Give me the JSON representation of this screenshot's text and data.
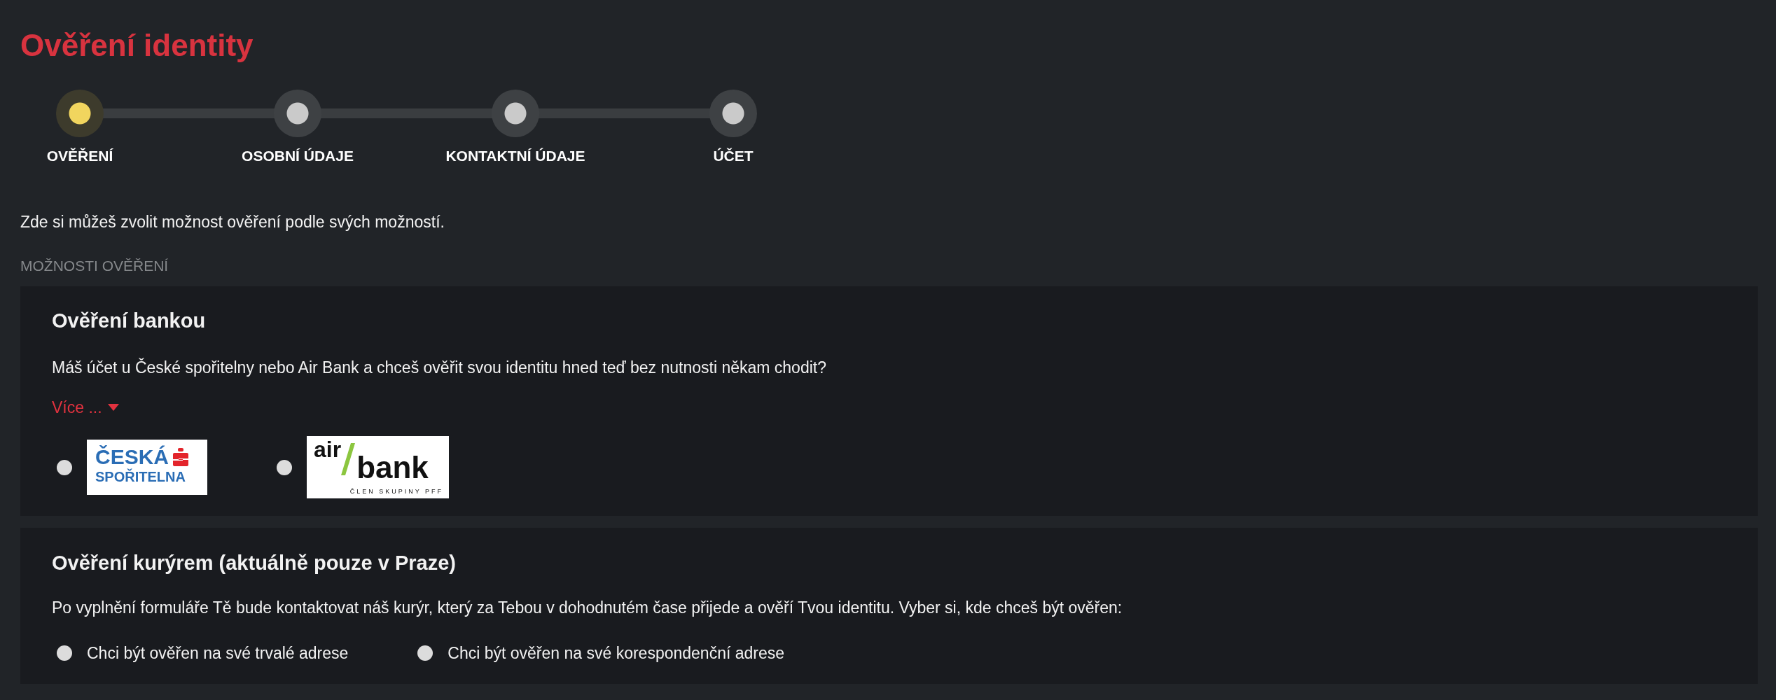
{
  "page": {
    "title": "Ověření identity"
  },
  "stepper": {
    "steps": [
      {
        "label": "OVĚŘENÍ",
        "selected": true
      },
      {
        "label": "OSOBNÍ ÚDAJE",
        "selected": false
      },
      {
        "label": "KONTAKTNÍ ÚDAJE",
        "selected": false
      },
      {
        "label": "ÚČET",
        "selected": false
      }
    ]
  },
  "intro": "Zde si můžeš zvolit možnost ověření podle svých možností.",
  "options_heading": "MOŽNOSTI OVĚŘENÍ",
  "methods": [
    {
      "title": "Ověření bankou",
      "description": "Máš účet u České spořitelny nebo Air Bank a chceš ověřit svou identitu hned teď bez nutnosti někam chodit?",
      "more_link": "Více ...",
      "options": [
        {
          "kind": "ceska",
          "selected": false,
          "logo_words": [
            "ČESKÁ",
            "SPOŘITELNA"
          ]
        },
        {
          "kind": "airbank",
          "selected": false,
          "logo_words": [
            "air",
            "bank"
          ],
          "tagline": "ČLEN SKUPINY PFF"
        }
      ]
    },
    {
      "title": "Ověření kurýrem (aktuálně pouze v Praze)",
      "description": "Po vyplnění formuláře Tě bude kontaktovat náš kurýr, který za Tebou v dohodnutém čase přijede a ověří Tvou identitu. Vyber si, kde chceš být ověřen:",
      "options": [
        {
          "kind": "text",
          "selected": false,
          "label": "Chci být ověřen na své trvalé adrese"
        },
        {
          "kind": "text",
          "selected": false,
          "label": "Chci být ověřen na své korespondenční adrese"
        }
      ]
    }
  ]
}
